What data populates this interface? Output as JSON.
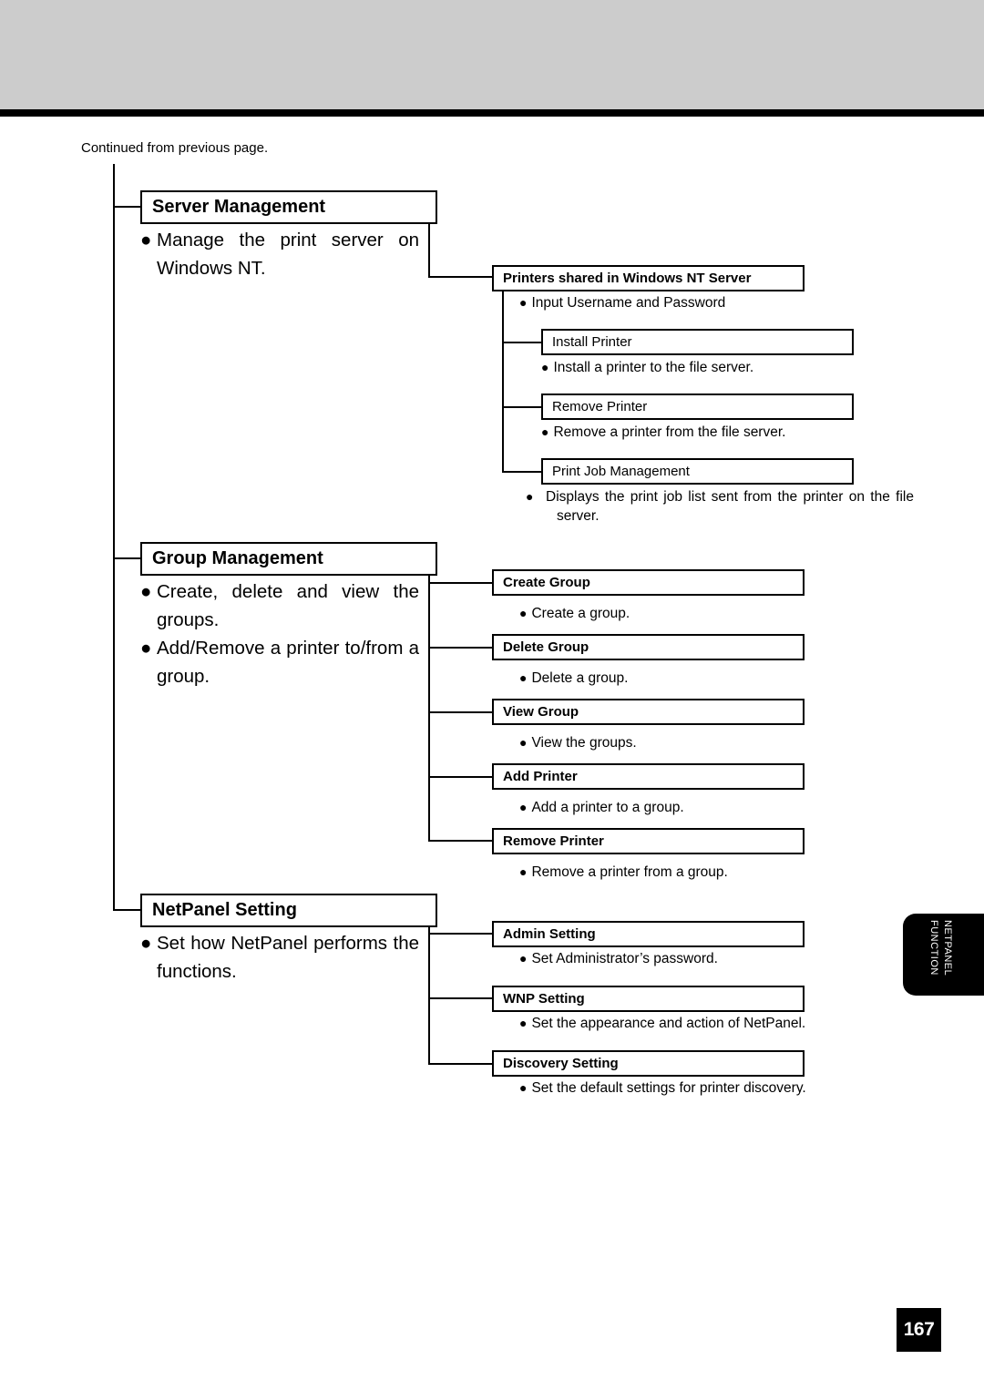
{
  "header": {
    "continued_text": "Continued from previous page."
  },
  "sections": [
    {
      "title": "Server Management",
      "bullets": [
        "Manage the print server on Windows NT."
      ],
      "children": [
        {
          "title": "Printers shared in Windows NT Server",
          "description": "Input Username and Password",
          "children": [
            {
              "title": "Install Printer",
              "description": "Install a printer to the file server."
            },
            {
              "title": "Remove Printer",
              "description": "Remove a printer from the file server."
            },
            {
              "title": "Print Job Management",
              "description": "Displays the print job list sent from the printer on the file server."
            }
          ]
        }
      ]
    },
    {
      "title": "Group Management",
      "bullets": [
        "Create, delete and view the groups.",
        "Add/Remove a printer to/from a group."
      ],
      "children": [
        {
          "title": "Create Group",
          "description": "Create a group."
        },
        {
          "title": "Delete Group",
          "description": "Delete a group."
        },
        {
          "title": "View Group",
          "description": "View the groups."
        },
        {
          "title": "Add Printer",
          "description": "Add a printer to a group."
        },
        {
          "title": "Remove Printer",
          "description": "Remove a printer from a group."
        }
      ]
    },
    {
      "title": "NetPanel Setting",
      "bullets": [
        "Set how NetPanel performs the functions."
      ],
      "children": [
        {
          "title": "Admin Setting",
          "description": "Set Administrator’s password."
        },
        {
          "title": "WNP Setting",
          "description": "Set the appearance and action of NetPanel."
        },
        {
          "title": "Discovery Setting",
          "description": "Set the default settings for printer discovery."
        }
      ]
    }
  ],
  "bullet_glyph": "●",
  "side_tab": {
    "line1": "NETPANEL",
    "line2": "FUNCTION"
  },
  "page_number": "167"
}
